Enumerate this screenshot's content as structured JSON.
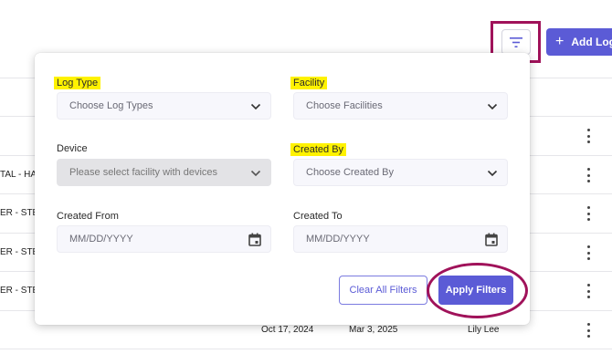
{
  "toolbar": {
    "filter_icon": "filter-icon",
    "add_log_label": "Add Log"
  },
  "table": {
    "rows": [
      {
        "left": ""
      },
      {
        "left": "TAL - HAN"
      },
      {
        "left": "ER - STE"
      },
      {
        "left": "ER - STE"
      },
      {
        "left": "ER - STE"
      },
      {
        "left": "",
        "created_from": "Oct 17, 2024",
        "created_to": "Mar 3, 2025",
        "created_by": "Lily Lee"
      }
    ]
  },
  "filter_panel": {
    "log_type": {
      "label": "Log Type",
      "placeholder": "Choose Log Types"
    },
    "facility": {
      "label": "Facility",
      "placeholder": "Choose Facilities"
    },
    "device": {
      "label": "Device",
      "placeholder": "Please select facility with devices"
    },
    "created_by": {
      "label": "Created By",
      "placeholder": "Choose Created By"
    },
    "created_from": {
      "label": "Created From",
      "placeholder": "MM/DD/YYYY"
    },
    "created_to": {
      "label": "Created To",
      "placeholder": "MM/DD/YYYY"
    },
    "clear_label": "Clear All Filters",
    "apply_label": "Apply Filters"
  },
  "colors": {
    "accent": "#5b5bd6",
    "highlight": "#fff200",
    "annotation": "#a0125a"
  }
}
